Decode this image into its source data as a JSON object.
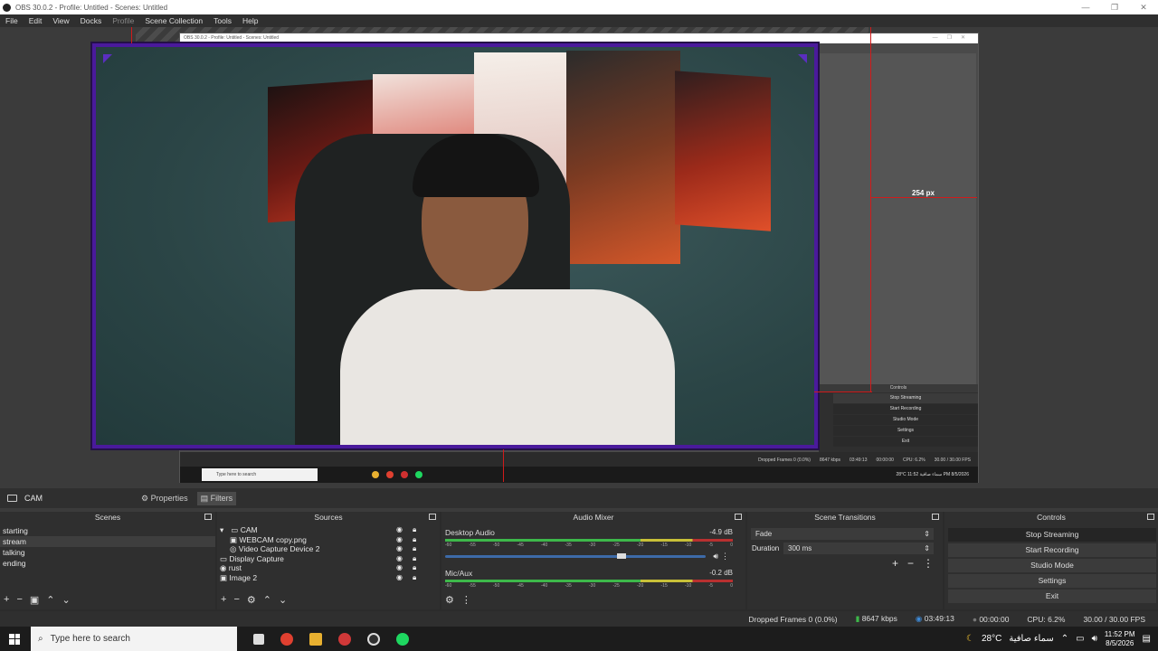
{
  "window": {
    "title": "OBS 30.0.2 - Profile: Untitled - Scenes: Untitled"
  },
  "menu": [
    "File",
    "Edit",
    "View",
    "Docks",
    "Profile",
    "Scene Collection",
    "Tools",
    "Help"
  ],
  "nested": {
    "title": "OBS 30.0.2 - Profile: Untitled - Scenes: Untitled",
    "controls_header": "Controls",
    "buttons": [
      "Stop Streaming",
      "Start Recording",
      "Studio Mode",
      "Settings",
      "Exit"
    ],
    "status": {
      "dropped": "Dropped Frames 0 (0.0%)",
      "kbps": "8647 kbps",
      "time": "03:49:13",
      "rec": "00:00:00",
      "cpu": "CPU: 6.2%",
      "fps": "30.00 / 30.00 FPS"
    },
    "taskbar_search": "Type here to search",
    "tray": "28°C  سماء صافية  11:52 PM 8/5/2026"
  },
  "guide_label": "254 px",
  "dock_bar": {
    "scene": "CAM",
    "properties": "Properties",
    "filters": "Filters"
  },
  "scenes": {
    "header": "Scenes",
    "items": [
      "starting",
      "stream",
      "talking",
      "ending"
    ],
    "selected": 1
  },
  "sources": {
    "header": "Sources",
    "items": [
      {
        "name": "CAM",
        "indent": 1,
        "icon": "folder"
      },
      {
        "name": "WEBCAM copy.png",
        "indent": 2,
        "icon": "image"
      },
      {
        "name": "Video Capture Device 2",
        "indent": 2,
        "icon": "camera"
      },
      {
        "name": "Display Capture",
        "indent": 0,
        "icon": "monitor"
      },
      {
        "name": "rust",
        "indent": 0,
        "icon": "eye"
      },
      {
        "name": "Image 2",
        "indent": 0,
        "icon": "image"
      }
    ]
  },
  "mixer": {
    "header": "Audio Mixer",
    "channels": [
      {
        "name": "Desktop Audio",
        "db": "-4.9 dB",
        "level": 0.66
      },
      {
        "name": "Mic/Aux",
        "db": "-0.2 dB",
        "level": 0.58
      }
    ],
    "ticks": [
      "-60",
      "-55",
      "-50",
      "-45",
      "-40",
      "-35",
      "-30",
      "-25",
      "-20",
      "-15",
      "-10",
      "-5",
      "0"
    ]
  },
  "transitions": {
    "header": "Scene Transitions",
    "type": "Fade",
    "duration_label": "Duration",
    "duration": "300 ms"
  },
  "controls": {
    "header": "Controls",
    "buttons": [
      "Stop Streaming",
      "Start Recording",
      "Studio Mode",
      "Settings",
      "Exit"
    ]
  },
  "status": {
    "dropped": "Dropped Frames 0 (0.0%)",
    "kbps": "8647 kbps",
    "stream_time": "03:49:13",
    "rec_time": "00:00:00",
    "cpu": "CPU: 6.2%",
    "fps": "30.00 / 30.00 FPS"
  },
  "taskbar": {
    "search": "Type here to search",
    "temp": "28°C",
    "weather": "سماء صافية",
    "time": "11:52 PM",
    "date": "8/5/2026"
  }
}
